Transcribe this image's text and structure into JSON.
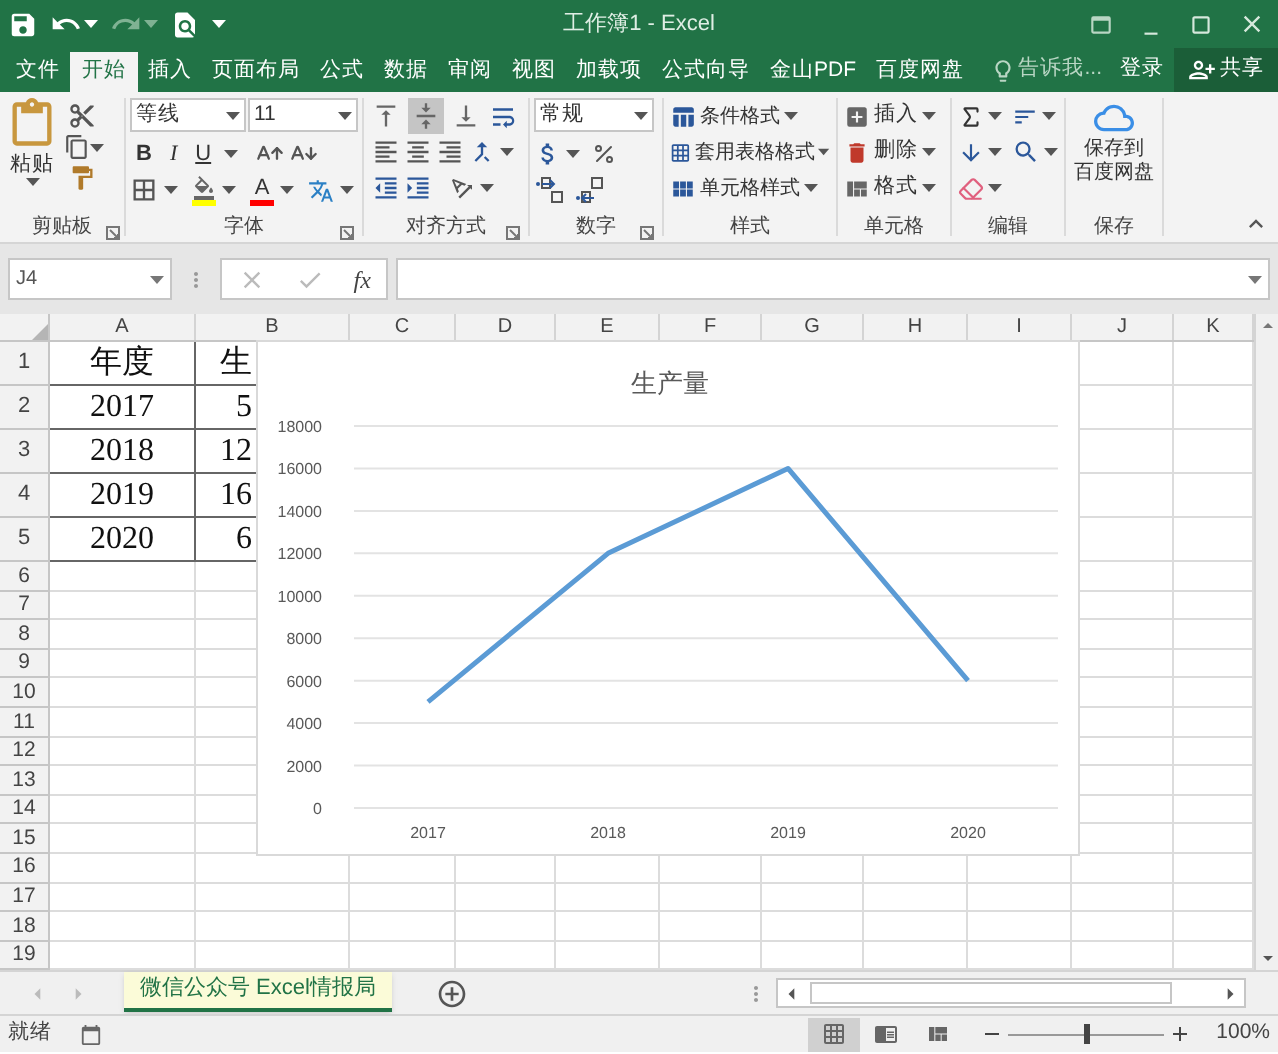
{
  "window": {
    "title": "工作簿1 - Excel"
  },
  "tabs": [
    {
      "label": "文件",
      "selected": false
    },
    {
      "label": "开始",
      "selected": true
    },
    {
      "label": "插入",
      "selected": false
    },
    {
      "label": "页面布局",
      "selected": false
    },
    {
      "label": "公式",
      "selected": false
    },
    {
      "label": "数据",
      "selected": false
    },
    {
      "label": "审阅",
      "selected": false
    },
    {
      "label": "视图",
      "selected": false
    },
    {
      "label": "加载项",
      "selected": false
    },
    {
      "label": "公式向导",
      "selected": false
    },
    {
      "label": "金山PDF",
      "selected": false
    },
    {
      "label": "百度网盘",
      "selected": false
    }
  ],
  "tell_me": "告诉我...",
  "account": {
    "sign_in": "登录",
    "share": "共享"
  },
  "ribbon": {
    "clipboard": {
      "paste": "粘贴",
      "label": "剪贴板"
    },
    "font": {
      "name": "等线",
      "size": "11",
      "bold": "B",
      "italic": "I",
      "underline": "U",
      "font_color": "A",
      "label": "字体"
    },
    "alignment": {
      "vertical": [
        {
          "selected": false
        },
        {
          "selected": true
        },
        {
          "selected": false
        }
      ],
      "label": "对齐方式"
    },
    "number": {
      "format": "常规",
      "label": "数字"
    },
    "styles": {
      "items": [
        "条件格式",
        "套用表格格式",
        "单元格样式"
      ],
      "label": "样式"
    },
    "cells": {
      "items": [
        "插入",
        "删除",
        "格式"
      ],
      "label": "单元格"
    },
    "editing": {
      "label": "编辑"
    },
    "baidu": {
      "button": [
        "保存到",
        "百度网盘"
      ],
      "label": "保存"
    }
  },
  "formula_bar": {
    "name_box": "J4",
    "function_label": "fx"
  },
  "sheet": {
    "columns": [
      "A",
      "B",
      "C",
      "D",
      "E",
      "F",
      "G",
      "H",
      "I",
      "J",
      "K"
    ],
    "rows": [
      {
        "number": "1",
        "cells": [
          "年度",
          "生"
        ]
      },
      {
        "number": "2",
        "cells": [
          "2017",
          "5"
        ]
      },
      {
        "number": "3",
        "cells": [
          "2018",
          "12"
        ]
      },
      {
        "number": "4",
        "cells": [
          "2019",
          "16"
        ]
      },
      {
        "number": "5",
        "cells": [
          "2020",
          "6"
        ]
      },
      {
        "number": "6"
      },
      {
        "number": "7"
      },
      {
        "number": "8"
      },
      {
        "number": "9"
      },
      {
        "number": "10"
      },
      {
        "number": "11"
      },
      {
        "number": "12"
      },
      {
        "number": "13"
      },
      {
        "number": "14"
      },
      {
        "number": "15"
      },
      {
        "number": "16"
      },
      {
        "number": "17"
      },
      {
        "number": "18"
      },
      {
        "number": "19"
      }
    ],
    "chart": {
      "chart_data": {
        "type": "line",
        "title": "生产量",
        "categories": [
          "2017",
          "2018",
          "2019",
          "2020"
        ],
        "series": [
          {
            "color": "#5b9bd5",
            "values": [
              5000,
              12000,
              16000,
              6000
            ]
          }
        ],
        "grid": true,
        "ylim": [
          0,
          18000
        ],
        "yticks": [
          0,
          2000,
          4000,
          6000,
          8000,
          10000,
          12000,
          14000,
          16000,
          18000
        ]
      }
    }
  },
  "sheet_tabs": [
    {
      "label": "微信公众号 Excel情报局",
      "selected": true
    }
  ],
  "status_bar": {
    "status": "就绪",
    "views": [
      {
        "selected": true
      },
      {
        "selected": false
      },
      {
        "selected": false
      }
    ],
    "zoom": {
      "level": 0.5,
      "reading": "100%"
    }
  }
}
